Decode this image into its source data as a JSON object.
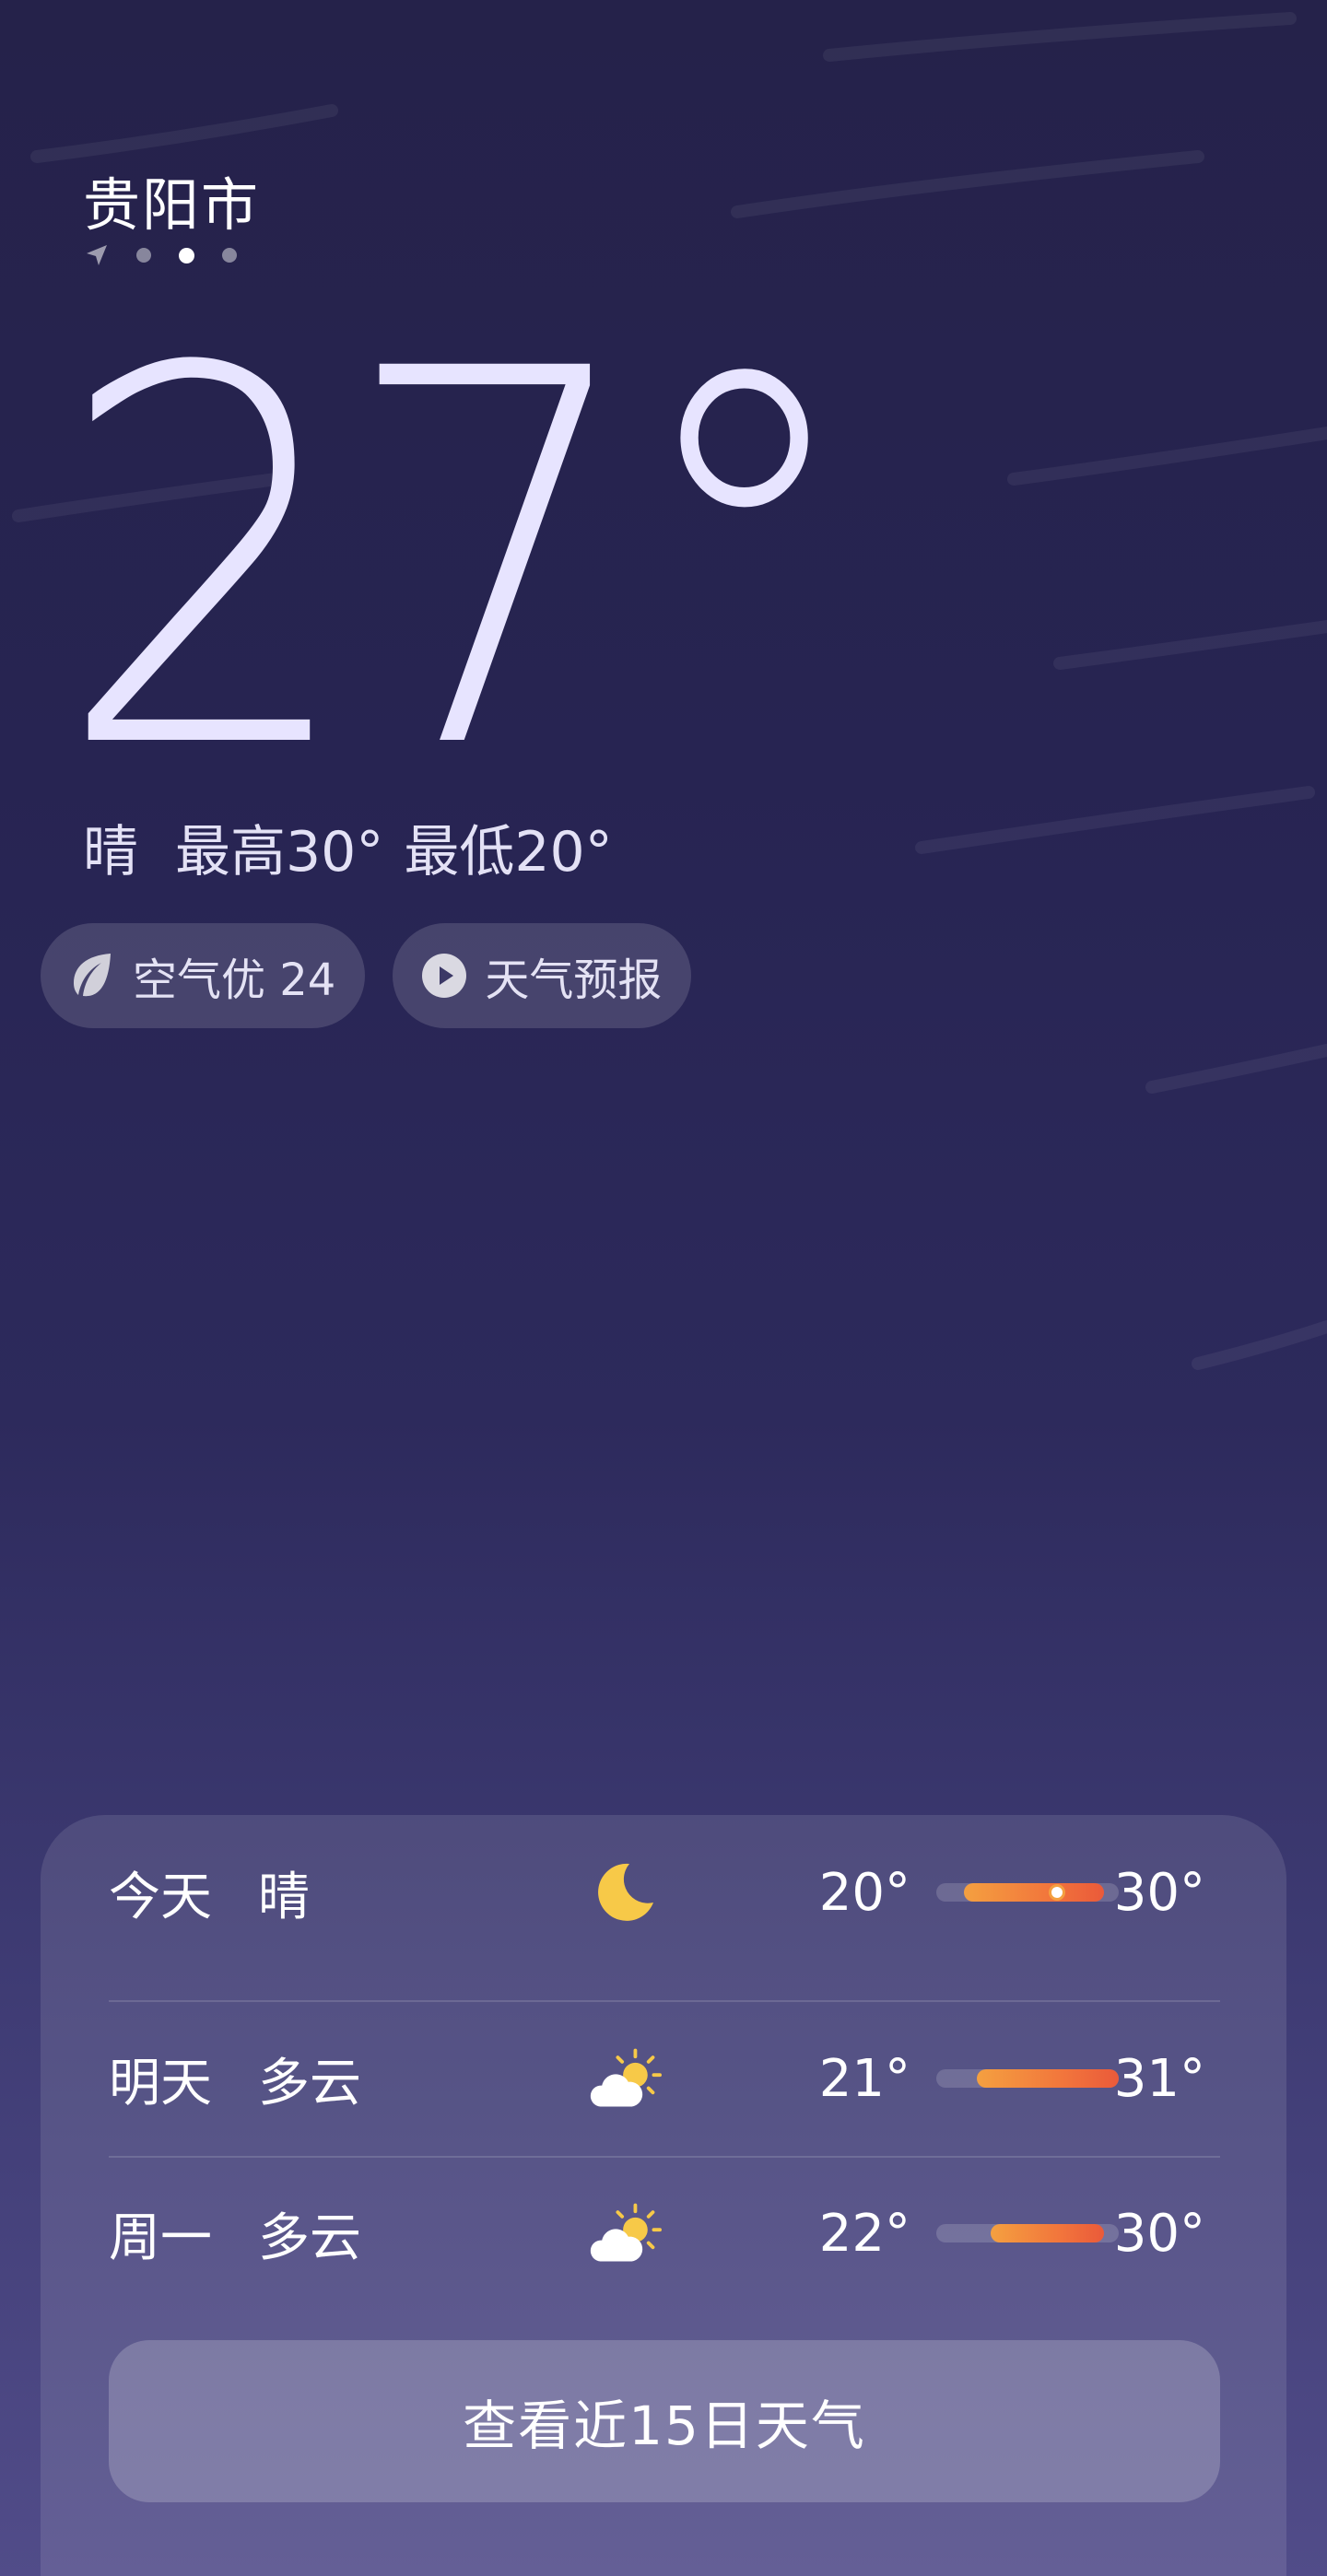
{
  "location": {
    "city": "贵阳市",
    "pages": [
      {
        "type": "location-icon"
      },
      {
        "type": "dot",
        "active": false
      },
      {
        "type": "dot",
        "active": true
      },
      {
        "type": "dot",
        "active": false
      }
    ]
  },
  "current": {
    "temperature": "27°",
    "condition": "晴",
    "high": "最高30°",
    "low": "最低20°"
  },
  "pills": {
    "air": {
      "label": "空气优 24",
      "icon": "leaf-icon"
    },
    "forecast": {
      "label": "天气预报",
      "icon": "play-icon"
    }
  },
  "daily": [
    {
      "day": "今天",
      "condition": "晴",
      "icon": "moon-icon",
      "low": "20°",
      "high": "30°",
      "range_start": 0.15,
      "range_end": 0.92,
      "current_pos": 0.66
    },
    {
      "day": "明天",
      "condition": "多云",
      "icon": "partly-cloudy-icon",
      "low": "21°",
      "high": "31°",
      "range_start": 0.22,
      "range_end": 1.0
    },
    {
      "day": "周一",
      "condition": "多云",
      "icon": "partly-cloudy-icon",
      "low": "22°",
      "high": "30°",
      "range_start": 0.3,
      "range_end": 0.92
    }
  ],
  "more_button": {
    "label": "查看近15日天气"
  },
  "colors": {
    "background_top": "#25224a",
    "background_bottom": "#514c89",
    "accent_orange": "#f4a040",
    "accent_red": "#ea5a3a",
    "sun_yellow": "#f7c948"
  }
}
